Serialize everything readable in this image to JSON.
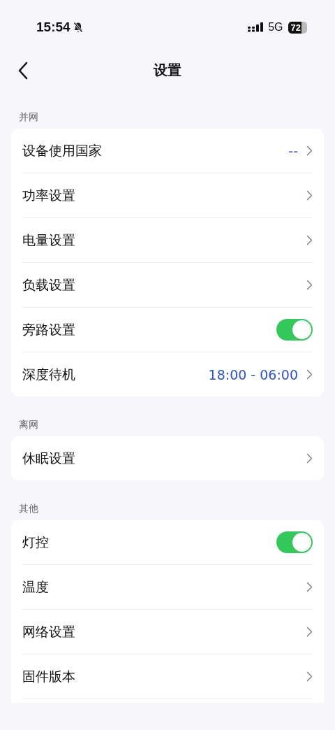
{
  "status_bar": {
    "time": "15:54",
    "network": "5G",
    "battery": "72"
  },
  "nav": {
    "title": "设置"
  },
  "sections": [
    {
      "title": "并网",
      "items": [
        {
          "kind": "link",
          "label": "设备使用国家",
          "value": "--"
        },
        {
          "kind": "link",
          "label": "功率设置"
        },
        {
          "kind": "link",
          "label": "电量设置"
        },
        {
          "kind": "link",
          "label": "负载设置"
        },
        {
          "kind": "toggle",
          "label": "旁路设置",
          "on": true
        },
        {
          "kind": "link",
          "label": "深度待机",
          "value": "18:00 - 06:00"
        }
      ]
    },
    {
      "title": "离网",
      "items": [
        {
          "kind": "link",
          "label": "休眠设置"
        }
      ]
    },
    {
      "title": "其他",
      "items": [
        {
          "kind": "toggle",
          "label": "灯控",
          "on": true
        },
        {
          "kind": "link",
          "label": "温度"
        },
        {
          "kind": "link",
          "label": "网络设置"
        },
        {
          "kind": "link",
          "label": "固件版本"
        }
      ]
    }
  ]
}
